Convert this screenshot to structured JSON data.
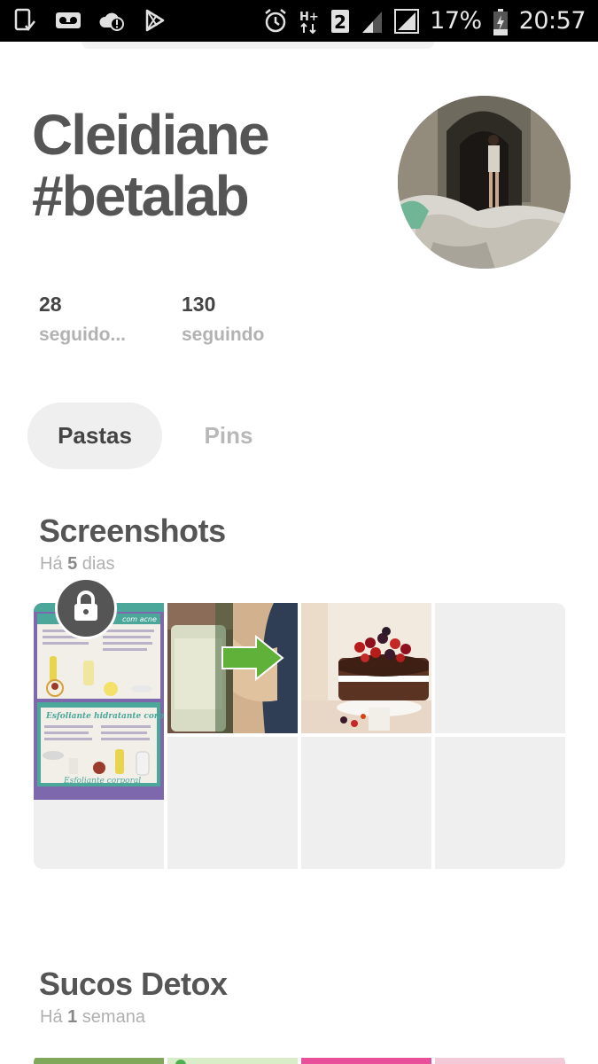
{
  "status_bar": {
    "battery_percent": "17%",
    "time": "20:57",
    "network_slot": "2",
    "left_icons": [
      "screenshot-icon",
      "voicemail-icon",
      "alert-cloud-icon",
      "play-store-icon"
    ],
    "right_icons": [
      "alarm-icon",
      "data-hplus-icon",
      "sim2-icon",
      "signal-icon",
      "signal-icon",
      "battery-charging-icon"
    ]
  },
  "profile": {
    "name_line1": "Cleidiane",
    "name_line2": "#betalab",
    "followers_count": "28",
    "followers_label": "seguido...",
    "following_count": "130",
    "following_label": "seguindo"
  },
  "tabs": [
    {
      "label": "Pastas",
      "active": true
    },
    {
      "label": "Pins",
      "active": false
    }
  ],
  "boards": [
    {
      "title": "Screenshots",
      "meta_prefix": "Há ",
      "meta_number": "5",
      "meta_suffix": " dias",
      "secret": true,
      "pin_texts": {
        "pin1_top": "com acne",
        "pin1_mid": "Esfoliante hidratante corporal",
        "pin1_bottom": "Esfoliante corporal"
      }
    },
    {
      "title": "Sucos Detox",
      "meta_prefix": "Há ",
      "meta_number": "1",
      "meta_suffix": " semana"
    }
  ],
  "colors": {
    "text_dark": "#555555",
    "text_muted": "#b2b2b2",
    "tab_active_bg": "#efefef",
    "placeholder": "#efefef",
    "lock_badge": "#555555"
  }
}
